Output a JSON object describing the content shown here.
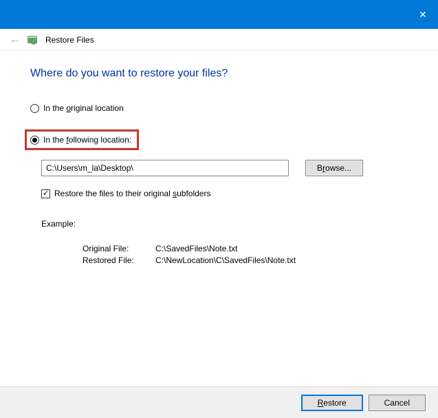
{
  "titlebar": {
    "close_glyph": "✕"
  },
  "header": {
    "back_glyph": "←",
    "app_title": "Restore Files"
  },
  "main": {
    "heading": "Where do you want to restore your files?",
    "radio_original_pre": "In the ",
    "radio_original_u": "o",
    "radio_original_post": "riginal location",
    "radio_following_pre": "In the ",
    "radio_following_u": "f",
    "radio_following_post": "ollowing location:",
    "path_value": "C:\\Users\\m_la\\Desktop\\",
    "browse_pre": "B",
    "browse_u": "r",
    "browse_post": "owse...",
    "checkbox_pre": "Restore the files to their original ",
    "checkbox_u": "s",
    "checkbox_post": "ubfolders",
    "example_title": "Example:",
    "example_original_label": "Original File:",
    "example_original_value": "C:\\SavedFiles\\Note.txt",
    "example_restored_label": "Restored File:",
    "example_restored_value": "C:\\NewLocation\\C\\SavedFiles\\Note.txt"
  },
  "footer": {
    "restore_u": "R",
    "restore_post": "estore",
    "cancel": "Cancel"
  }
}
